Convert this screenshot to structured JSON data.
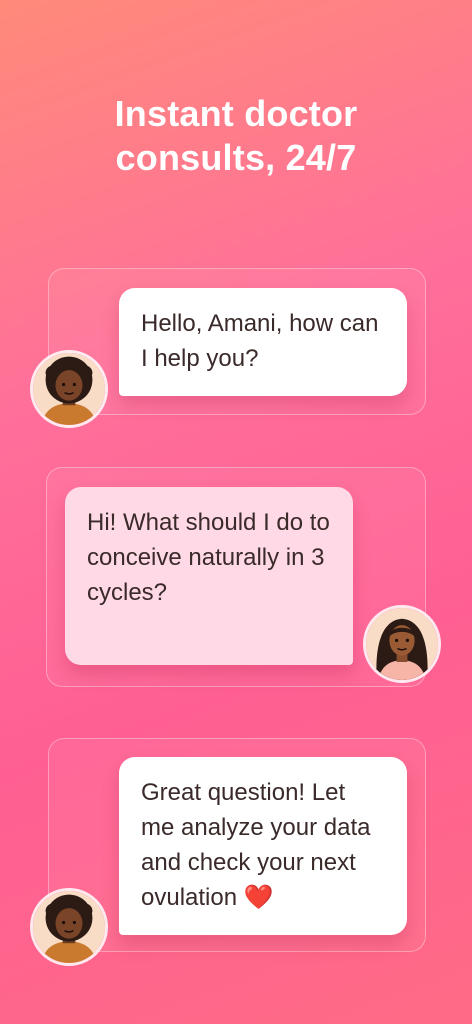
{
  "headline": {
    "line1": "Instant doctor",
    "line2": "consults, 24/7"
  },
  "messages": [
    {
      "sender": "doctor",
      "text": "Hello, Amani, how can I help you?"
    },
    {
      "sender": "user",
      "text": "Hi! What should I do to conceive naturally in 3 cycles?"
    },
    {
      "sender": "doctor",
      "text": "Great question! Let me analyze your data and check your next ovulation ❤️"
    }
  ],
  "avatars": {
    "doctor": "doctor-avatar-icon",
    "user": "user-avatar-icon"
  },
  "colors": {
    "background_top": "#ff8a7a",
    "background_mid": "#ff5f93",
    "bubble_white": "#ffffff",
    "bubble_pink": "#ffd9e6",
    "text": "#3a2a2a"
  }
}
